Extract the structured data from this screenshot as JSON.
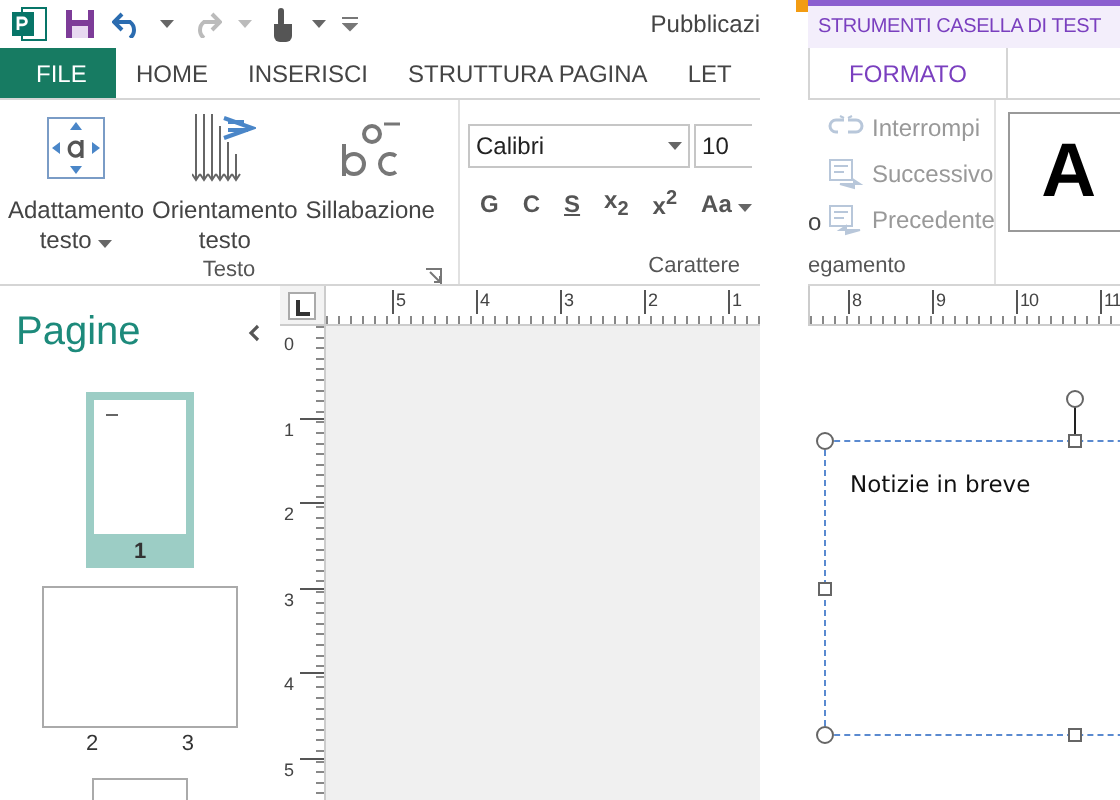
{
  "title_bar": {
    "title": "Pubblicazi"
  },
  "tabs": [
    {
      "label": "FILE",
      "kind": "file",
      "selected": false
    },
    {
      "label": "HOME",
      "kind": "tab",
      "selected": false
    },
    {
      "label": "INSERISCI",
      "kind": "tab",
      "selected": false
    },
    {
      "label": "STRUTTURA PAGINA",
      "kind": "tab",
      "selected": false
    },
    {
      "label": "LET",
      "kind": "tab",
      "selected": false
    }
  ],
  "ribbon": {
    "testo": {
      "label": "Testo",
      "buttons": [
        {
          "kind": "fit",
          "lines": [
            "Adattamento",
            "testo"
          ],
          "dropdown": true
        },
        {
          "kind": "direction",
          "lines": [
            "Orientamento",
            "testo"
          ],
          "dropdown": false
        },
        {
          "kind": "hyphen",
          "lines": [
            "Sillabazione"
          ],
          "dropdown": false
        }
      ]
    },
    "carattere": {
      "label": "Carattere",
      "font": "Calibri",
      "size": "10",
      "formats": [
        {
          "label": "G",
          "kind": "plain"
        },
        {
          "label": "C",
          "kind": "plain"
        },
        {
          "label": "S",
          "kind": "underline"
        },
        {
          "label": "x$_{2}$",
          "kind": "plain"
        },
        {
          "label": "x$^{2}$",
          "kind": "plain"
        },
        {
          "label": "Aa",
          "kind": "dropdown"
        }
      ]
    }
  },
  "pages_pane": {
    "title": "Pagine",
    "pages": [
      {
        "kind": "single",
        "labels": [
          "1"
        ],
        "selected": true
      },
      {
        "kind": "spread",
        "labels": [
          "2",
          "3"
        ],
        "selected": false
      },
      {
        "kind": "single",
        "selected": false
      }
    ]
  },
  "rulers": {
    "left_horizontal": [
      "5",
      "4",
      "3",
      "2",
      "1"
    ],
    "vertical": [
      "0",
      "1",
      "2",
      "3",
      "4",
      "5"
    ],
    "right_horizontal": [
      "8",
      "9",
      "10",
      "11"
    ]
  },
  "context_tabs": {
    "group": "STRUMENTI CASELLA DI TEST",
    "tabs": [
      {
        "label": "FORMATO",
        "selected": true
      }
    ]
  },
  "link_group": {
    "label": "egamento",
    "cut_label": "o",
    "buttons": [
      {
        "label": "Interrompi",
        "kind": "break",
        "disabled": true
      },
      {
        "label": "Successivo",
        "kind": "next",
        "disabled": true
      },
      {
        "label": "Precedente",
        "kind": "prev",
        "disabled": true
      }
    ],
    "style_preview": "A"
  },
  "text_box": {
    "text": "Notizie in breve"
  }
}
